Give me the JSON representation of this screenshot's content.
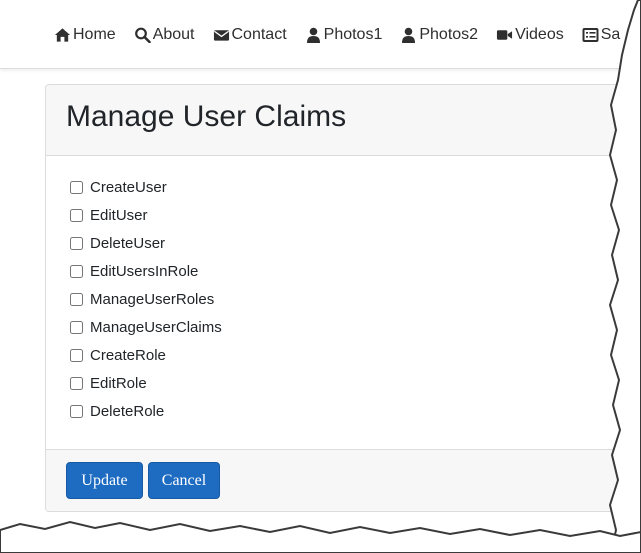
{
  "nav": {
    "items": [
      {
        "label": "Home",
        "icon": "home-icon"
      },
      {
        "label": "About",
        "icon": "search-icon"
      },
      {
        "label": "Contact",
        "icon": "envelope-icon"
      },
      {
        "label": "Photos1",
        "icon": "user-icon"
      },
      {
        "label": "Photos2",
        "icon": "user-icon"
      },
      {
        "label": "Videos",
        "icon": "video-camera-icon"
      },
      {
        "label": "Sa",
        "icon": "list-icon"
      }
    ]
  },
  "card": {
    "title": "Manage User Claims",
    "claims": [
      {
        "label": "CreateUser",
        "checked": false
      },
      {
        "label": "EditUser",
        "checked": false
      },
      {
        "label": "DeleteUser",
        "checked": false
      },
      {
        "label": "EditUsersInRole",
        "checked": false
      },
      {
        "label": "ManageUserRoles",
        "checked": false
      },
      {
        "label": "ManageUserClaims",
        "checked": false
      },
      {
        "label": "CreateRole",
        "checked": false
      },
      {
        "label": "EditRole",
        "checked": false
      },
      {
        "label": "DeleteRole",
        "checked": false
      }
    ],
    "update_label": "Update",
    "cancel_label": "Cancel"
  },
  "colors": {
    "primary_button": "#1d6cc2",
    "header_bg": "#f7f7f7",
    "text": "#212529"
  }
}
